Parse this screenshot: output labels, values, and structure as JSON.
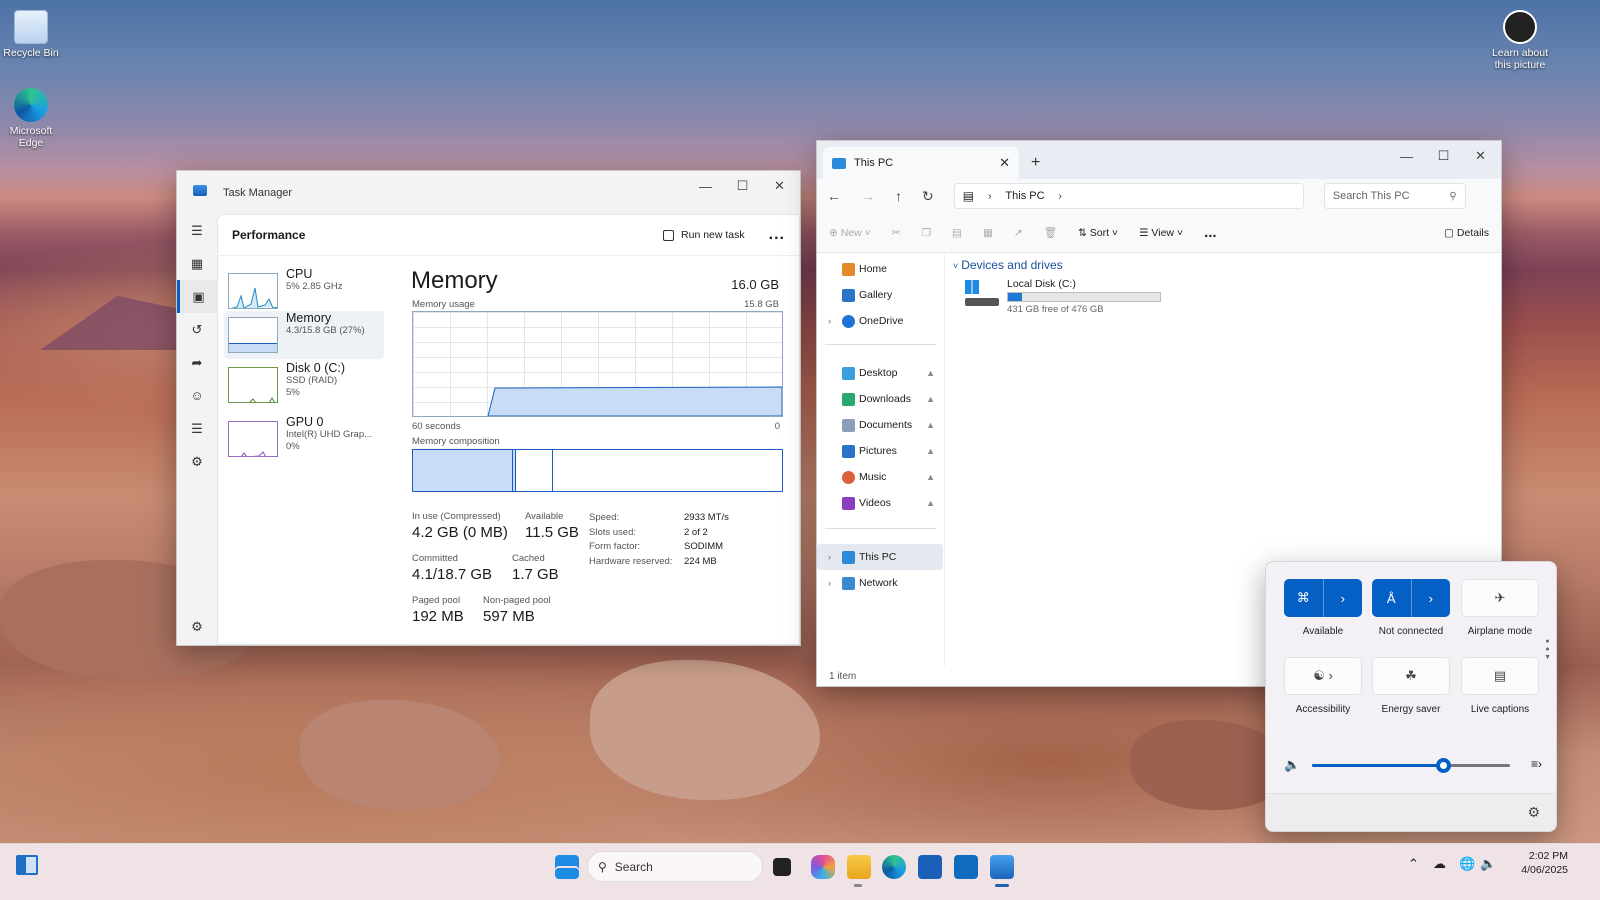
{
  "desktop": {
    "icons": [
      {
        "label": "Recycle Bin"
      },
      {
        "label": "Microsoft Edge"
      },
      {
        "label": "Learn about this picture"
      }
    ]
  },
  "task_manager": {
    "title": "Task Manager",
    "section": "Performance",
    "run_new_task": "Run new task",
    "more": "...",
    "perf_list": [
      {
        "name": "CPU",
        "line1": "5% 2.85 GHz",
        "line2": ""
      },
      {
        "name": "Memory",
        "line1": "4.3/15.8 GB (27%)",
        "line2": ""
      },
      {
        "name": "Disk 0 (C:)",
        "line1": "SSD (RAID)",
        "line2": "5%"
      },
      {
        "name": "GPU 0",
        "line1": "Intel(R) UHD Grap...",
        "line2": "0%"
      }
    ],
    "memory": {
      "title": "Memory",
      "total": "16.0 GB",
      "usage_label": "Memory usage",
      "usage_max": "15.8 GB",
      "axis_left": "60 seconds",
      "axis_right": "0",
      "composition_label": "Memory composition",
      "in_use_label": "In use (Compressed)",
      "in_use": "4.2 GB (0 MB)",
      "available_label": "Available",
      "available": "11.5 GB",
      "committed_label": "Committed",
      "committed": "4.1/18.7 GB",
      "cached_label": "Cached",
      "cached": "1.7 GB",
      "paged_label": "Paged pool",
      "paged": "192 MB",
      "nonpaged_label": "Non-paged pool",
      "nonpaged": "597 MB",
      "speed_label": "Speed:",
      "speed": "2933 MT/s",
      "slots_label": "Slots used:",
      "slots": "2 of 2",
      "form_label": "Form factor:",
      "form": "SODIMM",
      "reserved_label": "Hardware reserved:",
      "reserved": "224 MB"
    }
  },
  "explorer": {
    "tab_title": "This PC",
    "address": "This PC",
    "search_placeholder": "Search This PC",
    "commands": {
      "new": "New",
      "sort": "Sort",
      "view": "View",
      "more": "...",
      "details": "Details"
    },
    "nav": [
      {
        "label": "Home"
      },
      {
        "label": "Gallery"
      },
      {
        "label": "OneDrive"
      },
      {
        "label": "Desktop"
      },
      {
        "label": "Downloads"
      },
      {
        "label": "Documents"
      },
      {
        "label": "Pictures"
      },
      {
        "label": "Music"
      },
      {
        "label": "Videos"
      },
      {
        "label": "This PC"
      },
      {
        "label": "Network"
      }
    ],
    "group_header": "Devices and drives",
    "drive": {
      "name": "Local Disk (C:)",
      "free_text": "431 GB free of 476 GB",
      "used_fraction": 0.09
    },
    "status": "1 item"
  },
  "quick_settings": {
    "tiles": [
      {
        "label": "Available"
      },
      {
        "label": "Not connected"
      },
      {
        "label": "Airplane mode"
      },
      {
        "label": "Accessibility"
      },
      {
        "label": "Energy saver"
      },
      {
        "label": "Live captions"
      }
    ],
    "volume_fraction": 0.66
  },
  "taskbar": {
    "search": "Search",
    "time": "2:02 PM",
    "date": "4/06/2025"
  },
  "colors": {
    "accent": "#0560c6",
    "graph_fill": "#c9dcf6",
    "graph_line": "#1a5fbf"
  }
}
